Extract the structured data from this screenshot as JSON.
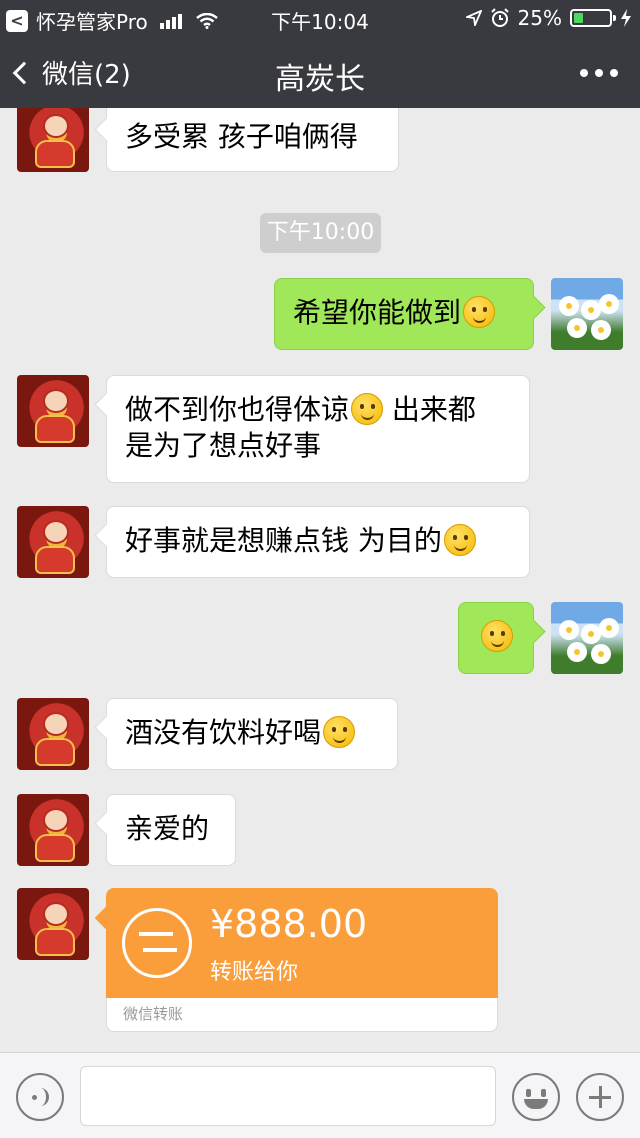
{
  "status": {
    "carrier": "怀孕管家Pro",
    "time": "下午10:04",
    "battery": "25%",
    "battery_level": 0.25
  },
  "nav": {
    "back_label": "微信(2)",
    "title": "高炭长"
  },
  "chat": {
    "time_divider": "下午10:00",
    "messages": [
      {
        "from": "other",
        "text": "多受累 孩子咱俩得"
      },
      {
        "from": "self",
        "text": "希望你能做到",
        "emoji": "smirk-emoji"
      },
      {
        "from": "other",
        "line1": "做不到你也得体谅",
        "line1_emoji": "grin-emoji",
        "line1_tail": " 出来都",
        "line2": "是为了想点好事"
      },
      {
        "from": "other",
        "text": "好事就是想赚点钱 为目的",
        "emoji": "hug-emoji"
      },
      {
        "from": "self",
        "text": "",
        "emoji": "surprised-emoji"
      },
      {
        "from": "other",
        "text": "酒没有饮料好喝",
        "emoji": "confused-emoji"
      },
      {
        "from": "other",
        "text": "亲爱的"
      }
    ],
    "transfer": {
      "amount": "¥888.00",
      "note": "转账给你",
      "footer": "微信转账"
    }
  },
  "colors": {
    "nav_bg": "#393a3f",
    "chat_bg": "#ebebeb",
    "self_bubble": "#a0e75a",
    "transfer_orange": "#fa9e3b"
  }
}
